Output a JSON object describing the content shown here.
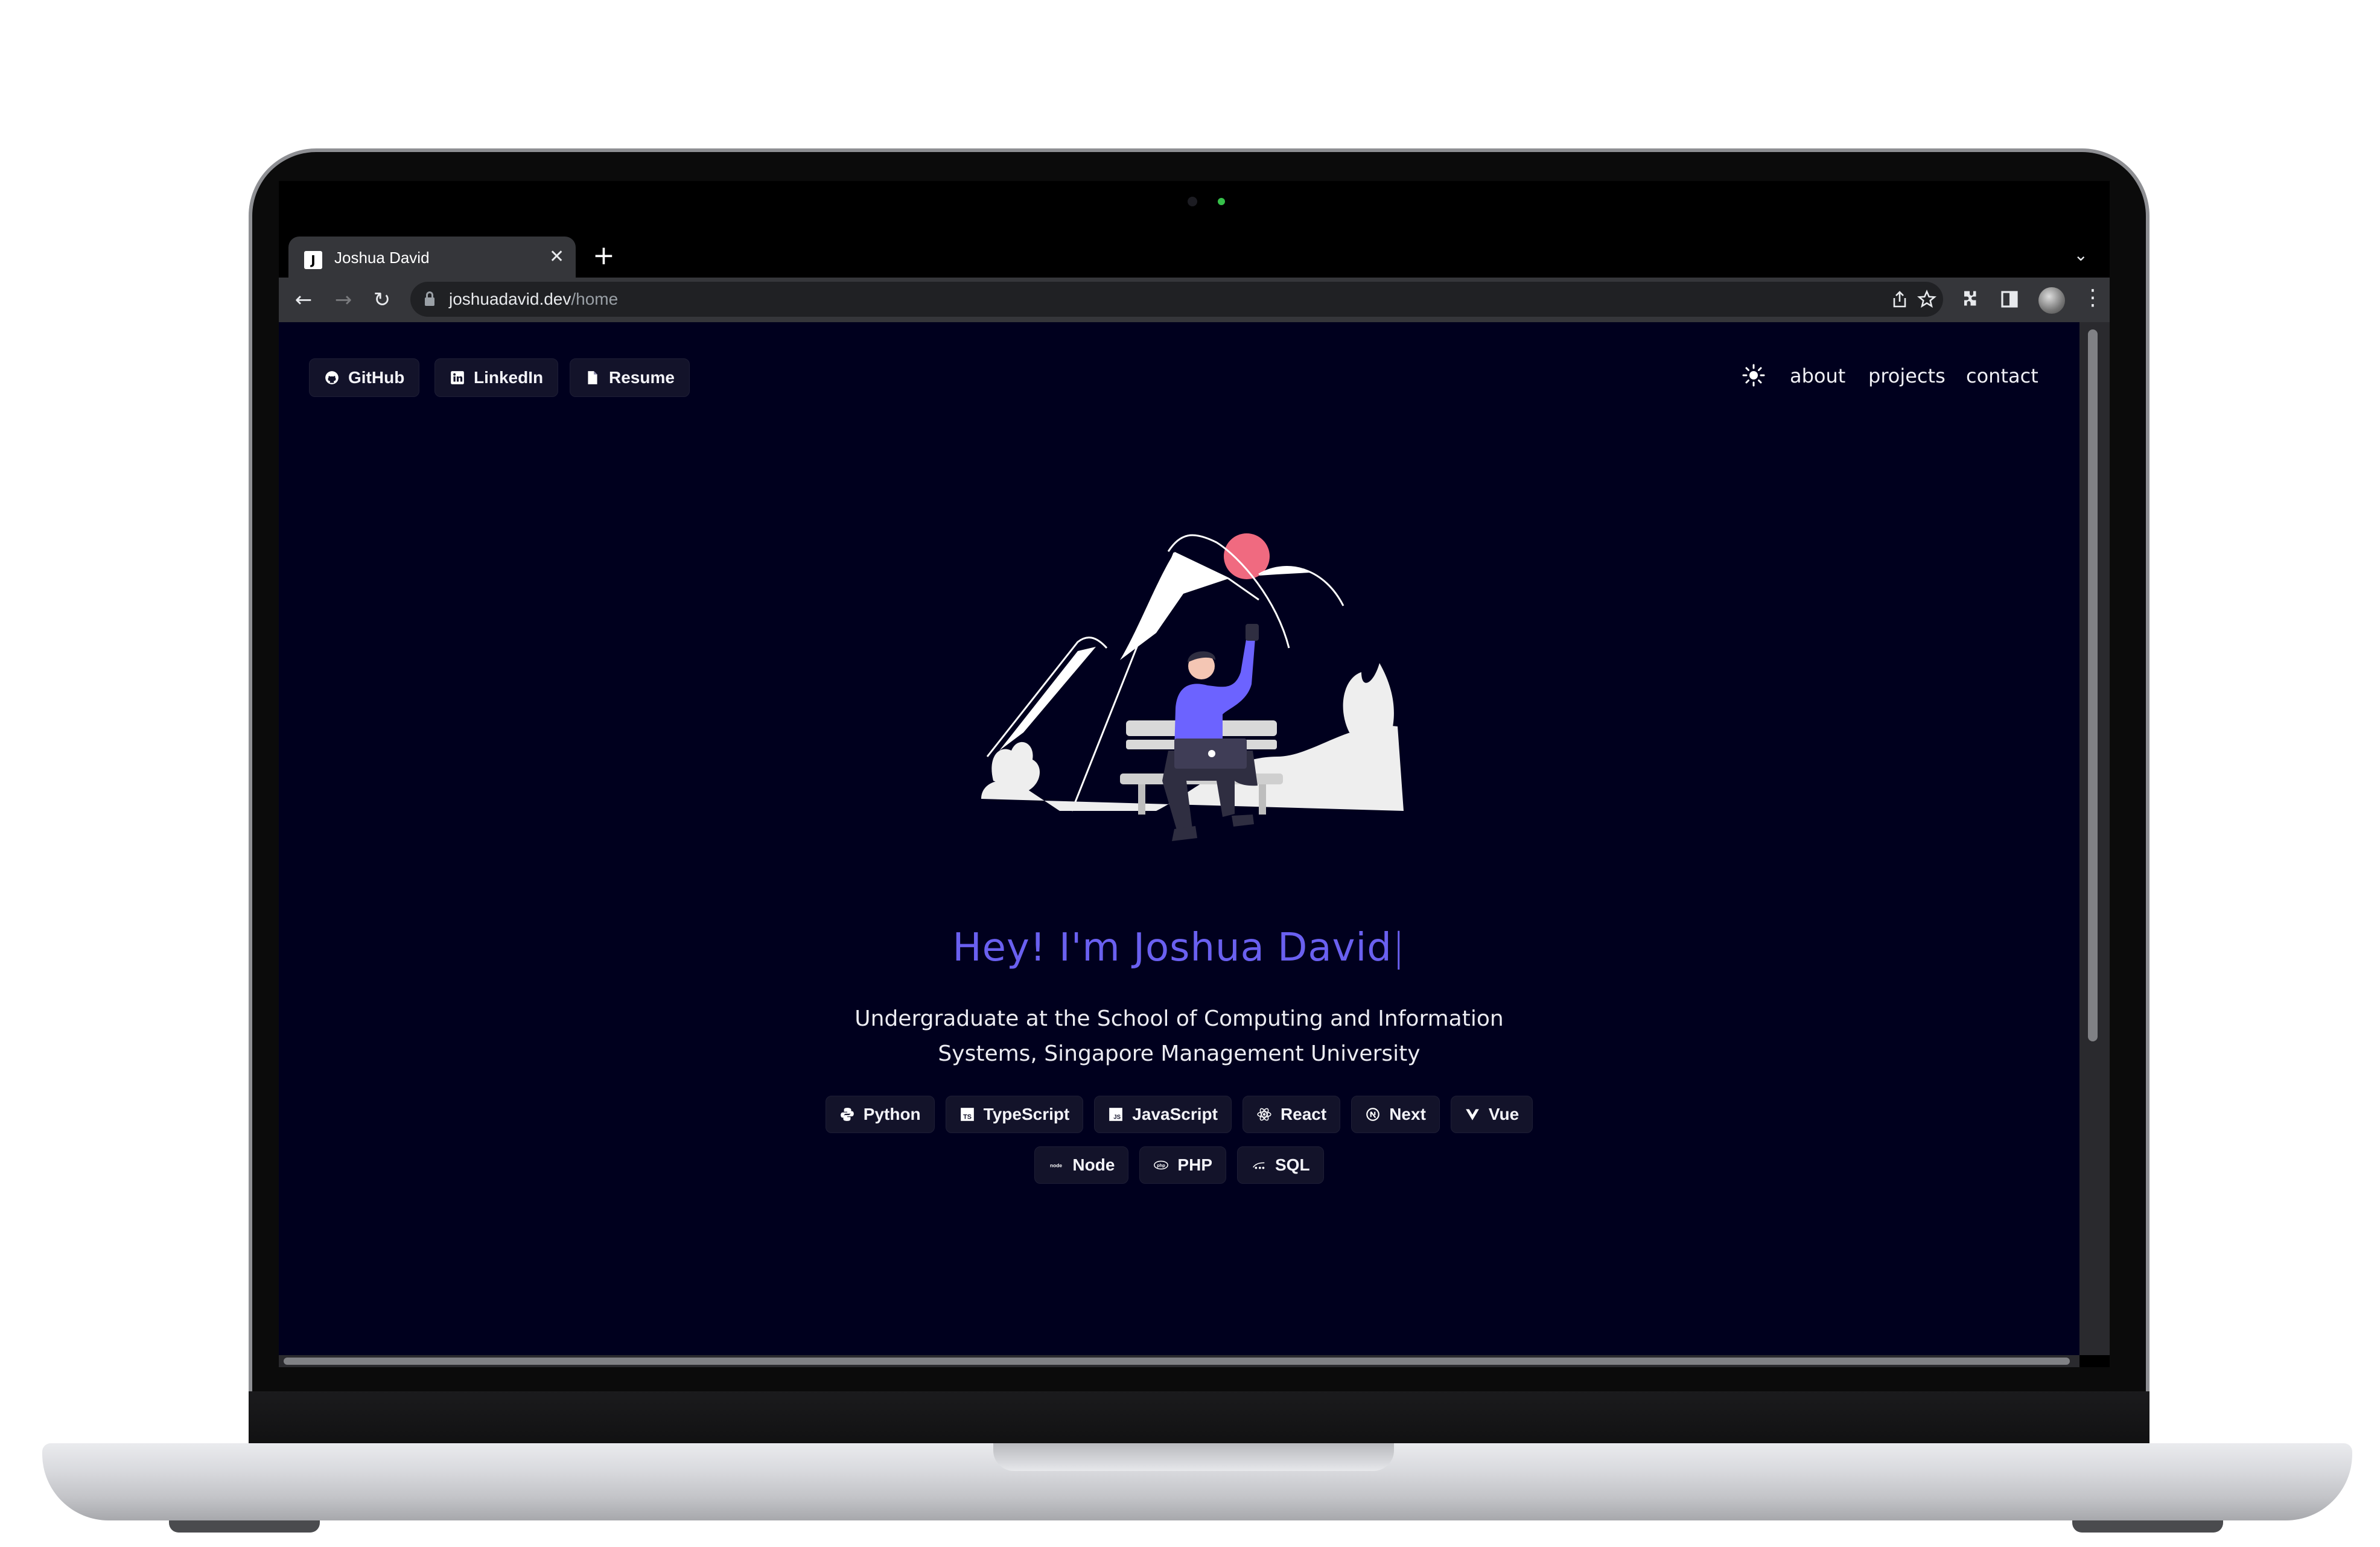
{
  "browser": {
    "tab_title": "Joshua David",
    "favicon_letter": "J",
    "url_host": "joshuadavid.dev",
    "url_path": "/home"
  },
  "header": {
    "left_links": [
      {
        "label": "GitHub",
        "icon": "github-icon"
      },
      {
        "label": "LinkedIn",
        "icon": "linkedin-icon"
      },
      {
        "label": "Resume",
        "icon": "document-icon"
      }
    ],
    "theme_toggle_icon": "sun-icon",
    "nav": [
      "about",
      "projects",
      "contact"
    ]
  },
  "hero": {
    "title": "Hey! I'm Joshua David",
    "cursor": "|",
    "subtitle_line1": "Undergraduate at the School of Computing and Information",
    "subtitle_line2": "Systems, Singapore Management University"
  },
  "tech": {
    "row1": [
      {
        "label": "Python",
        "icon": "python-icon"
      },
      {
        "label": "TypeScript",
        "icon": "typescript-icon"
      },
      {
        "label": "JavaScript",
        "icon": "javascript-icon"
      },
      {
        "label": "React",
        "icon": "react-icon"
      },
      {
        "label": "Next",
        "icon": "nextjs-icon"
      },
      {
        "label": "Vue",
        "icon": "vue-icon"
      }
    ],
    "row2": [
      {
        "label": "Node",
        "icon": "node-icon"
      },
      {
        "label": "PHP",
        "icon": "php-icon"
      },
      {
        "label": "SQL",
        "icon": "sql-icon"
      }
    ]
  },
  "colors": {
    "page_bg": "#00001e",
    "accent": "#6a60f0",
    "pill_bg": "#13132a"
  }
}
